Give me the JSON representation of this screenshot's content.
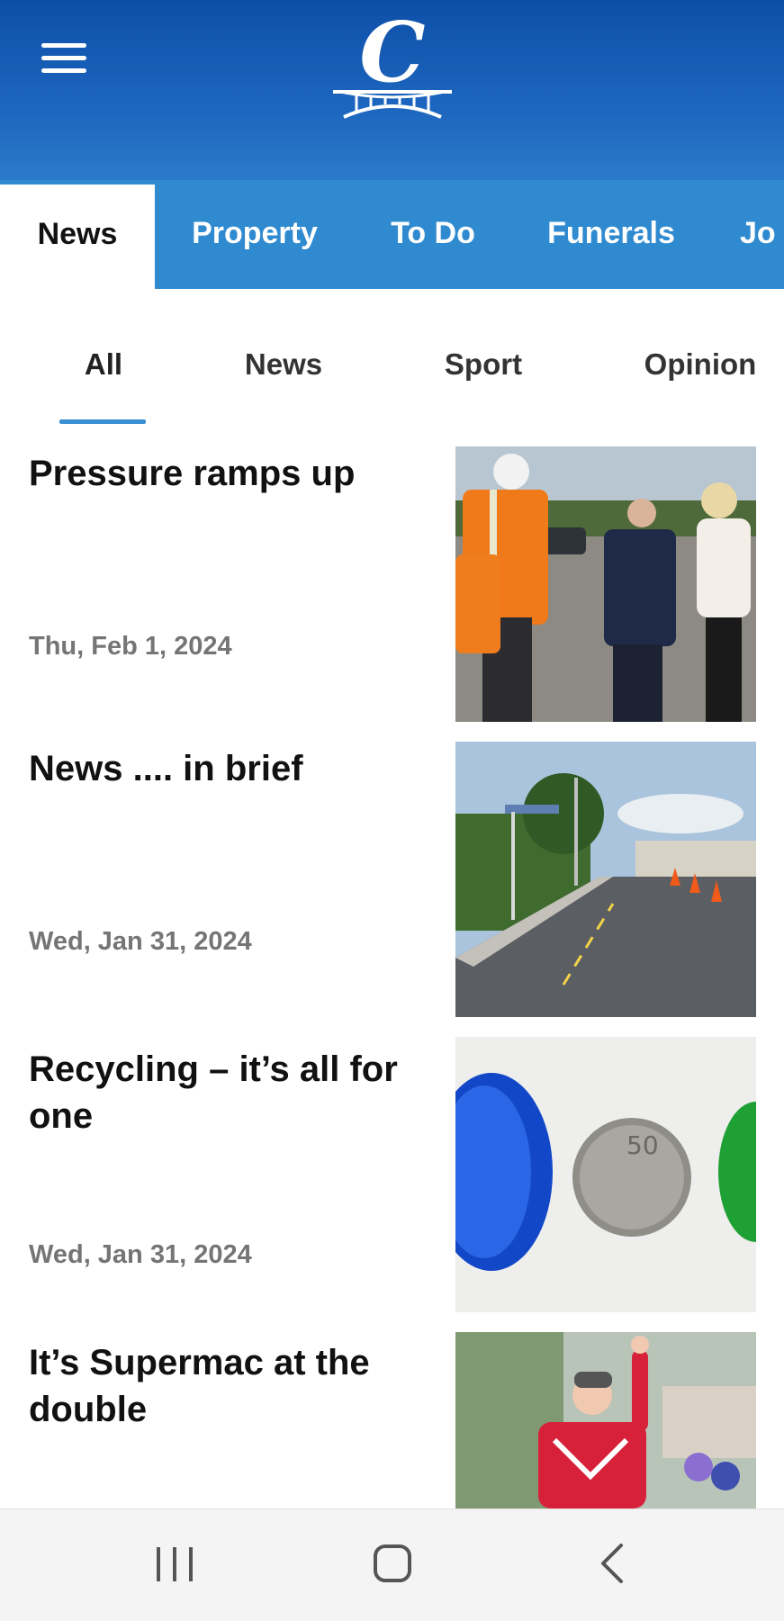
{
  "header": {
    "logo_letter": "C"
  },
  "top_tabs": [
    {
      "label": "News",
      "active": true
    },
    {
      "label": "Property",
      "active": false
    },
    {
      "label": "To Do",
      "active": false
    },
    {
      "label": "Funerals",
      "active": false
    },
    {
      "label": "Jo",
      "active": false
    }
  ],
  "sub_tabs": [
    {
      "label": "All",
      "active": true
    },
    {
      "label": "News",
      "active": false
    },
    {
      "label": "Sport",
      "active": false
    },
    {
      "label": "Opinion",
      "active": false
    }
  ],
  "articles": [
    {
      "title": "Pressure ramps up",
      "date": "Thu, Feb 1, 2024",
      "image": "officials-roadworks-photo"
    },
    {
      "title": "News .... in brief",
      "date": "Wed, Jan 31, 2024",
      "image": "road-cones-photo"
    },
    {
      "title": "Recycling – it’s all for one",
      "date": "Wed, Jan 31, 2024",
      "image": "bottle-caps-coin-photo"
    },
    {
      "title": "It’s Supermac  at the double",
      "date": "",
      "image": "jockey-photo"
    }
  ],
  "colors": {
    "header_top": "#0d4fa8",
    "tab_bar": "#2f8ad0",
    "indicator": "#3a8fd2"
  },
  "nav": {
    "recent_icon": "recent-apps-icon",
    "home_icon": "home-icon",
    "back_icon": "back-icon"
  }
}
